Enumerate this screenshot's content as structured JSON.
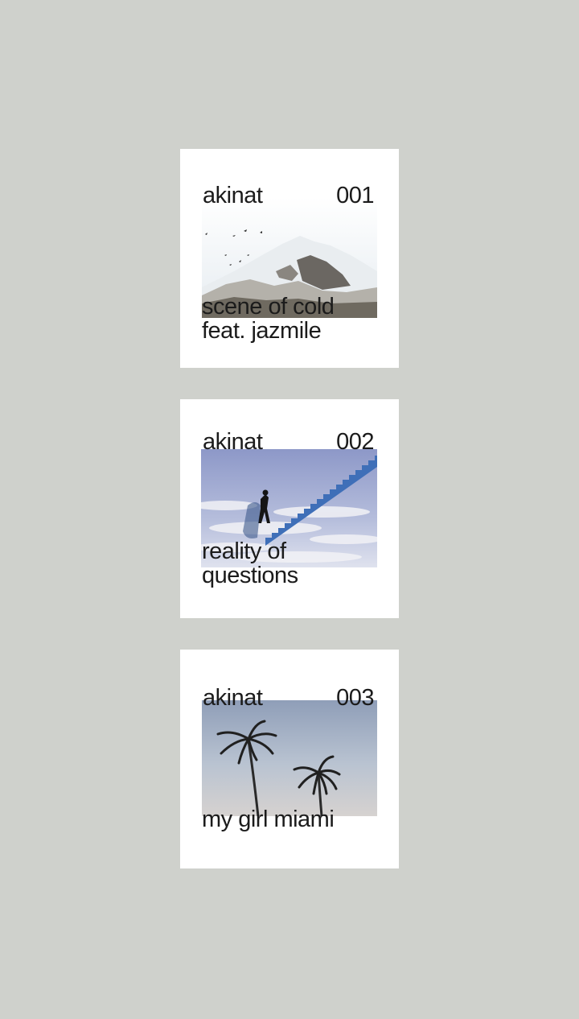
{
  "releases": [
    {
      "artist": "akinat",
      "number": "001",
      "title_lines": [
        "scene of cold",
        "feat. jazmile"
      ],
      "artwork": "snowy-mountain-birds"
    },
    {
      "artist": "akinat",
      "number": "002",
      "title_lines": [
        "reality of",
        "questions"
      ],
      "artwork": "man-climbing-sky-stairs"
    },
    {
      "artist": "akinat",
      "number": "003",
      "title_lines": [
        "my girl miami"
      ],
      "artwork": "palm-trees-sky"
    }
  ],
  "colors": {
    "background": "#cfd1cc",
    "card": "#ffffff",
    "text": "#1b1b1b"
  }
}
